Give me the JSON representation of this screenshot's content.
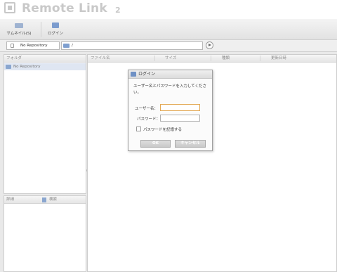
{
  "app": {
    "logo_text": "Remote Link",
    "logo_version": "2"
  },
  "toolbar": {
    "thumbnail_label": "サムネイル(S)",
    "login_label": "ログイン"
  },
  "address": {
    "repository": "No Repository",
    "path": "/"
  },
  "folder_panel": {
    "title": "フォルダ",
    "items": [
      {
        "label": "No Repository"
      }
    ]
  },
  "detail_panel": {
    "tab_detail": "詳細",
    "tab_search": "検索"
  },
  "file_list": {
    "columns": [
      "ファイル名",
      "サイズ",
      "種類",
      "更新日時"
    ]
  },
  "dialog": {
    "title": "ログイン",
    "message": "ユーザー名とパスワードを入力してください。",
    "username_label": "ユーザー名：",
    "password_label": "パスワード：",
    "username_value": "",
    "password_value": "",
    "remember_label": "パスワードを記憶する",
    "ok_label": "OK",
    "cancel_label": "キャンセル"
  },
  "colors": {
    "accent_focus": "#e3a956",
    "selection": "#dfe6f2",
    "button": "#c9c9c9"
  }
}
